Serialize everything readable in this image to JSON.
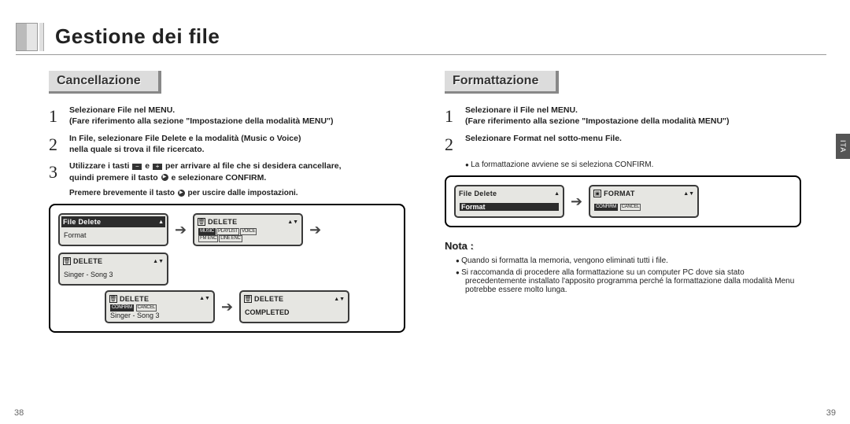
{
  "header": {
    "title": "Gestione dei file"
  },
  "left": {
    "section": "Cancellazione",
    "step1a": "Selezionare File nel MENU.",
    "step1b": "(Fare riferimento alla sezione \"Impostazione della modalità MENU\")",
    "step2a": "In File, selezionare File Delete e la modalità (Music o Voice)",
    "step2b": "nella quale si trova il file ricercato.",
    "step3a": "Utilizzare i tasti",
    "step3b": "e",
    "step3c": "per arrivare al file che si desidera cancellare,",
    "step3d": "quindi premere il tasto",
    "step3e": "e selezionare CONFIRM.",
    "step_exit_a": "Premere brevemente il tasto",
    "step_exit_b": "per uscire dalle impostazioni.",
    "lcd1": {
      "l1": "File Delete",
      "l2": "Format"
    },
    "lcd2": {
      "title": "DELETE",
      "tabs": [
        "MUSIC",
        "PLAYLIST",
        "VOICE"
      ],
      "tabs2": [
        "FM ENC",
        "LINE ENC"
      ]
    },
    "lcd3": {
      "title": "DELETE",
      "line": "Singer - Song 3"
    },
    "lcd4": {
      "title": "DELETE",
      "line": "Singer - Song 3",
      "opts": [
        "CONFIRM",
        "CANCEL"
      ]
    },
    "lcd5": {
      "title": "DELETE",
      "line": "COMPLETED"
    }
  },
  "right": {
    "section": "Formattazione",
    "step1a": "Selezionare il File nel MENU.",
    "step1b": "(Fare riferimento alla sezione \"Impostazione della modalità MENU\")",
    "step2a": "Selezionare Format nel sotto-menu File.",
    "step2b": "La formattazione avviene se si seleziona CONFIRM.",
    "lcd1": {
      "l1": "File Delete",
      "l2": "Format"
    },
    "lcd2": {
      "title": "FORMAT",
      "opts": [
        "CONFIRM",
        "CANCEL"
      ]
    },
    "note_label": "Nota :",
    "note1": "Quando si formatta la memoria, vengono eliminati tutti i file.",
    "note2": "Si raccomanda di procedere alla formattazione su un computer PC dove sia stato precedentemente installato l'apposito programma perché la formattazione dalla modalità Menu potrebbe essere molto lunga."
  },
  "page_left": "38",
  "page_right": "39",
  "side_tab": "ITA"
}
